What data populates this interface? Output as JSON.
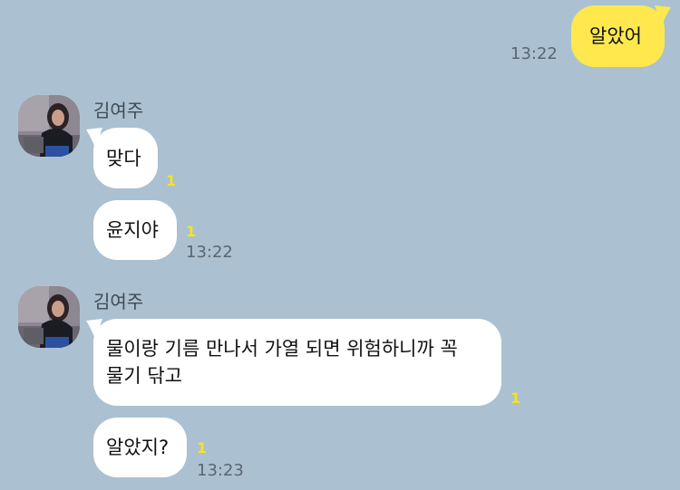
{
  "messages": {
    "outgoing_1": {
      "text": "알았어",
      "time": "13:22"
    },
    "group_1": {
      "sender": "김여주",
      "msg_1": {
        "text": "맞다",
        "unread": "1"
      },
      "msg_2": {
        "text": "윤지야",
        "unread": "1",
        "time": "13:22"
      }
    },
    "group_2": {
      "sender": "김여주",
      "msg_1": {
        "text_line1": "물이랑 기름 만나서 가열 되면 위험하니까 꼭",
        "text_line2": "물기 닦고",
        "unread": "1"
      },
      "msg_2": {
        "text": "알았지?",
        "unread": "1",
        "time": "13:23"
      }
    }
  },
  "colors": {
    "background": "#abc1d1",
    "outgoing_bubble": "#fee84d",
    "incoming_bubble": "#ffffff",
    "unread_count": "#f5e320"
  }
}
